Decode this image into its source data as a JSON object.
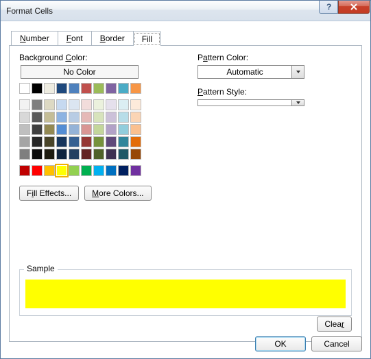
{
  "window": {
    "title": "Format Cells"
  },
  "tabs": {
    "number": "Number",
    "font": "Font",
    "border": "Border",
    "fill": "Fill",
    "active": "fill"
  },
  "fill": {
    "bgcolor_label": "Background Color:",
    "bgcolor_u": "C",
    "nocolor": "No Color",
    "fill_effects": "Fill Effects...",
    "fill_effects_u": "I",
    "more_colors": "More Colors...",
    "more_colors_u": "M",
    "pattern_color_label": "Pattern Color:",
    "pattern_color_u": "A",
    "pattern_color_value": "Automatic",
    "pattern_style_label": "Pattern Style:",
    "pattern_style_u": "P",
    "pattern_style_value": ""
  },
  "swatches": {
    "theme_row1": [
      "#ffffff",
      "#000000",
      "#eeece1",
      "#1f497d",
      "#4f81bd",
      "#c0504d",
      "#9bbb59",
      "#8064a2",
      "#4bacc6",
      "#f79646"
    ],
    "theme_shades": [
      [
        "#f2f2f2",
        "#7f7f7f",
        "#ddd9c3",
        "#c6d9f0",
        "#dbe5f1",
        "#f2dcdb",
        "#ebf1dd",
        "#e5e0ec",
        "#dbeef3",
        "#fdeada"
      ],
      [
        "#d8d8d8",
        "#595959",
        "#c4bd97",
        "#8db3e2",
        "#b8cce4",
        "#e5b9b7",
        "#d7e3bc",
        "#ccc1d9",
        "#b7dde8",
        "#fbd5b5"
      ],
      [
        "#bfbfbf",
        "#3f3f3f",
        "#938953",
        "#548dd4",
        "#95b3d7",
        "#d99694",
        "#c3d69b",
        "#b2a2c7",
        "#92cddc",
        "#fac08f"
      ],
      [
        "#a5a5a5",
        "#262626",
        "#494429",
        "#17365d",
        "#366092",
        "#953734",
        "#76923c",
        "#5f497a",
        "#31859b",
        "#e36c09"
      ],
      [
        "#7f7f7f",
        "#0c0c0c",
        "#1d1b10",
        "#0f243e",
        "#244061",
        "#632423",
        "#4f6128",
        "#3f3151",
        "#205867",
        "#974806"
      ]
    ],
    "standard": [
      "#c00000",
      "#ff0000",
      "#ffc000",
      "#ffff00",
      "#92d050",
      "#00b050",
      "#00b0f0",
      "#0070c0",
      "#002060",
      "#7030a0"
    ],
    "selected": "#ffff00"
  },
  "sample": {
    "label": "Sample",
    "color": "#ffff00"
  },
  "buttons": {
    "clear": "Clear",
    "clear_u": "R",
    "ok": "OK",
    "cancel": "Cancel"
  }
}
